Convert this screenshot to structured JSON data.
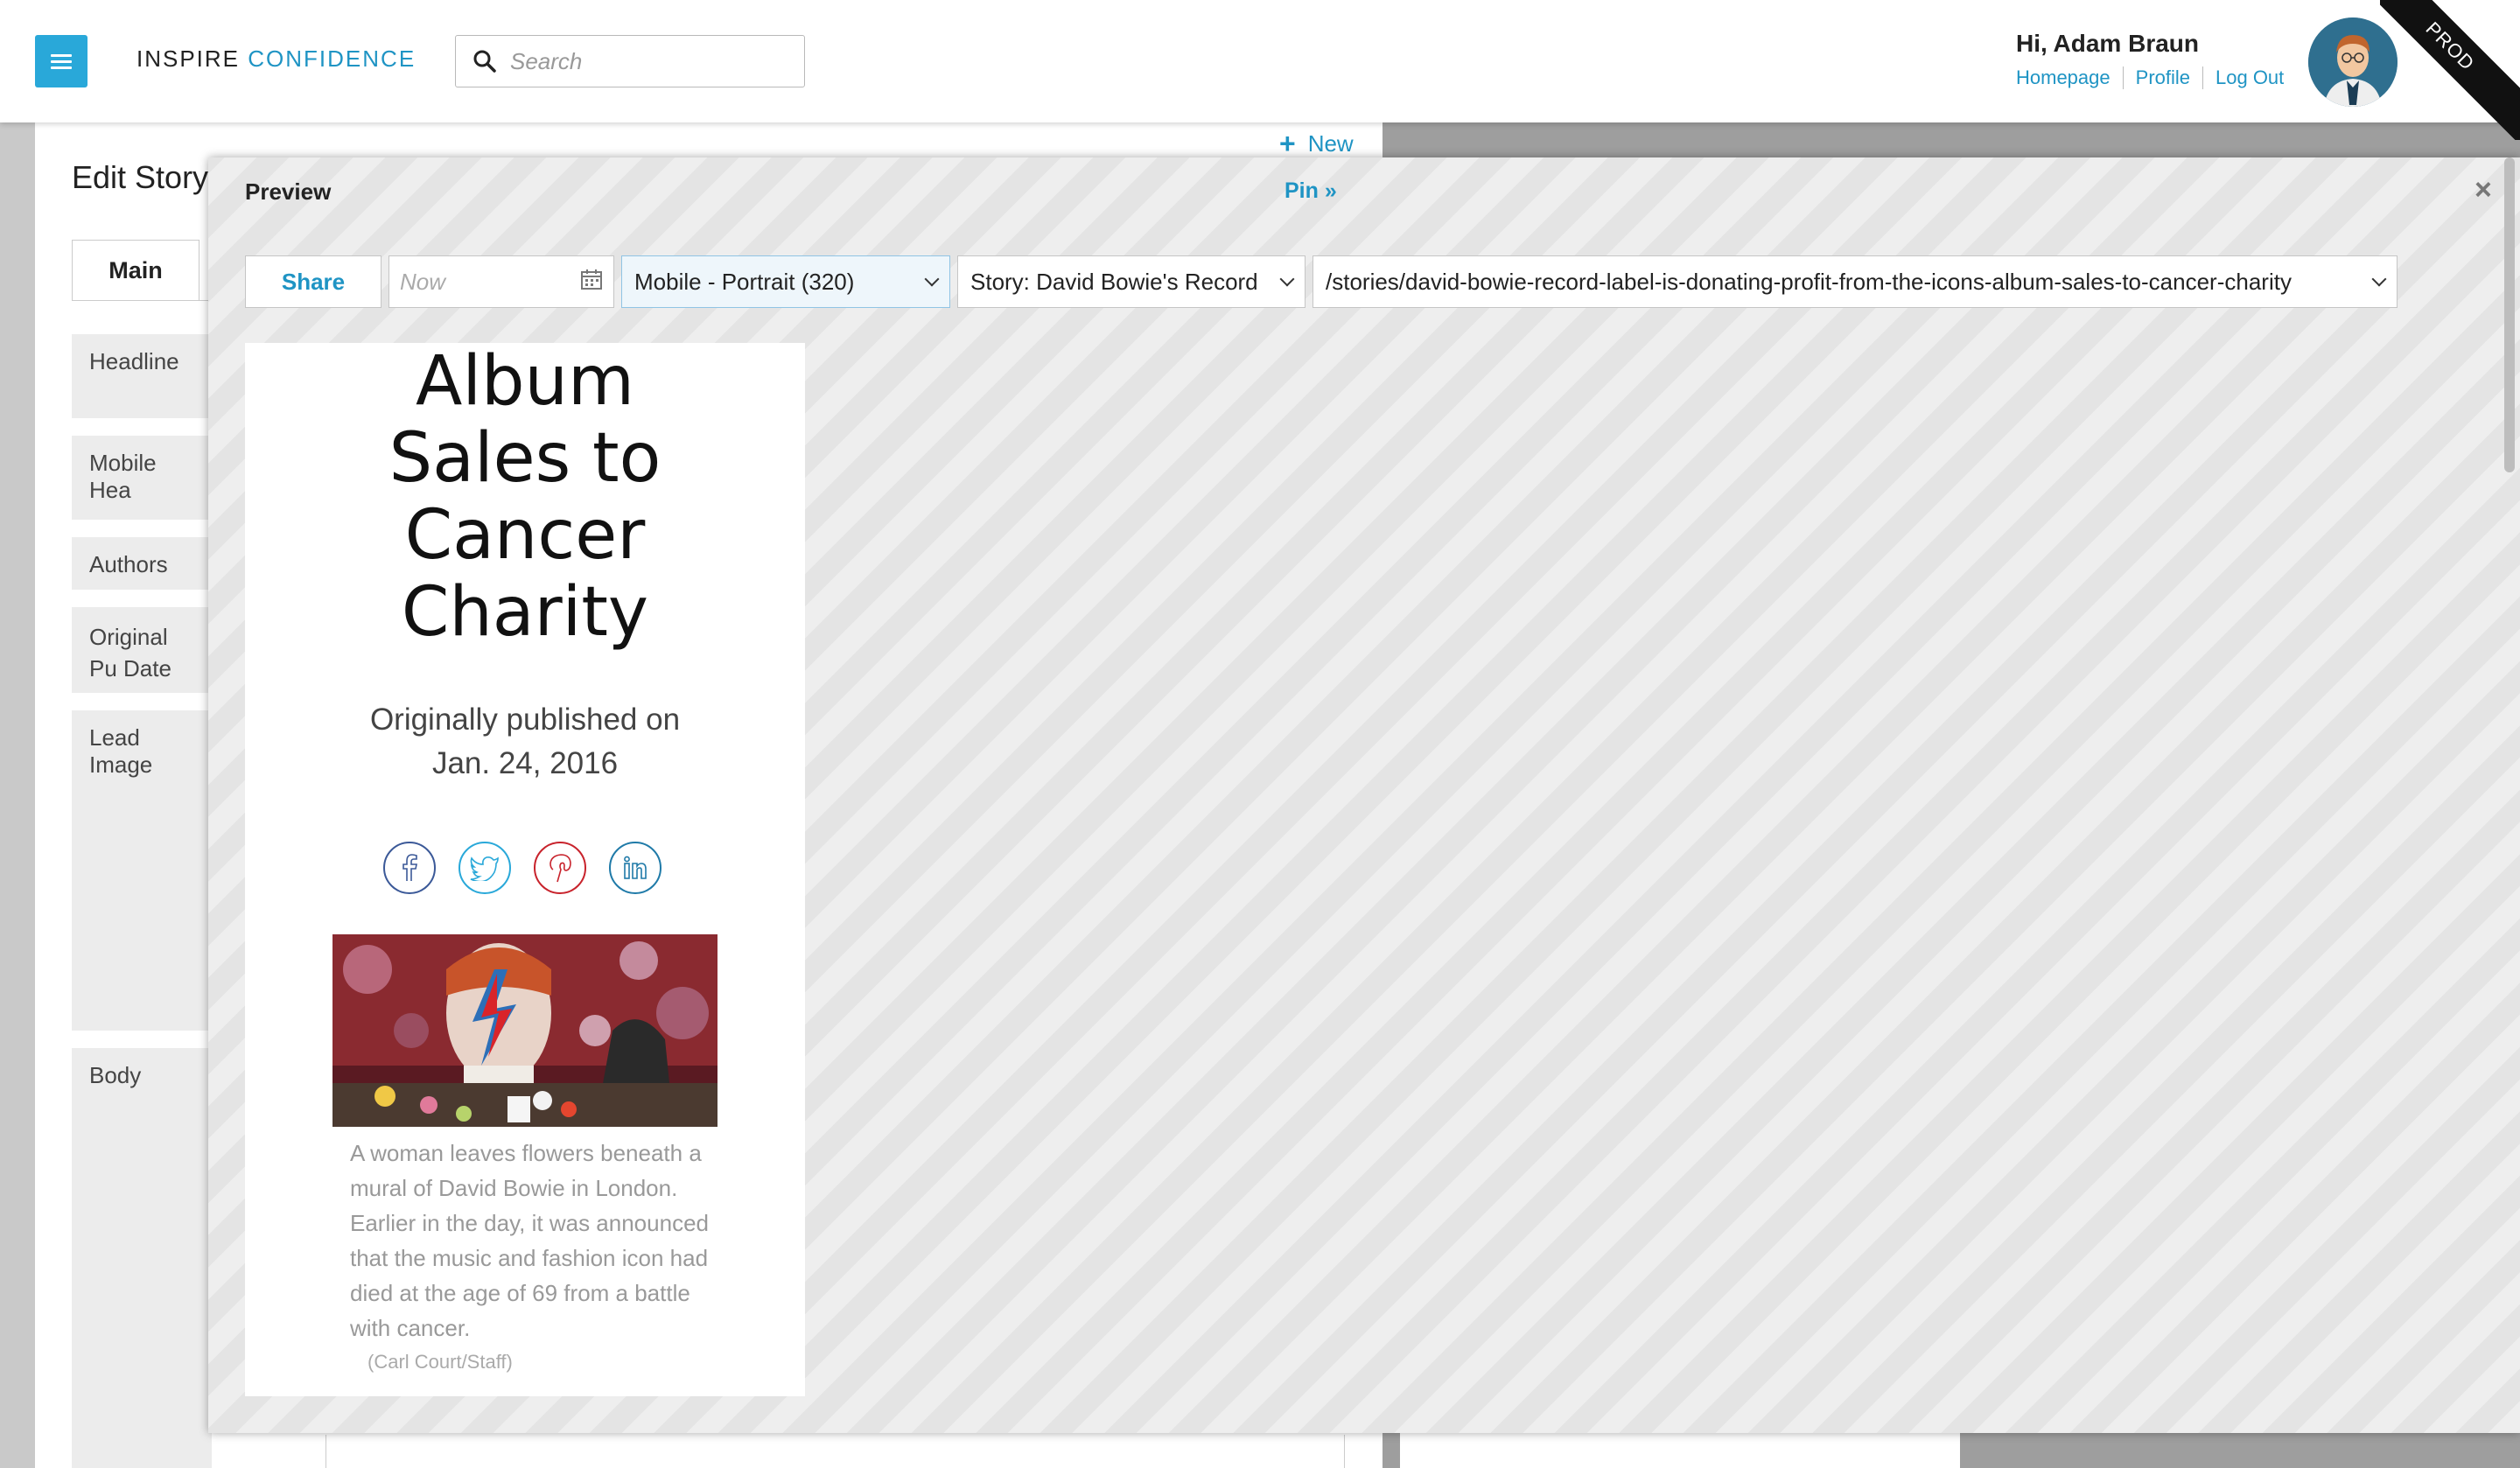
{
  "header": {
    "logo_part1": "INSPIRE",
    "logo_part2": "CONFIDENCE",
    "search_placeholder": "Search",
    "greeting": "Hi, Adam Braun",
    "links": [
      "Homepage",
      "Profile",
      "Log Out"
    ],
    "environment_badge": "PROD"
  },
  "editor": {
    "new_label": "New",
    "title": "Edit Story",
    "tab_main": "Main",
    "fields": [
      "Headline",
      "Mobile Hea",
      "Authors",
      "Original Pu Date",
      "Lead Image",
      "Body"
    ]
  },
  "preview": {
    "title": "Preview",
    "pin_label": "Pin »",
    "close_label": "×",
    "share_label": "Share",
    "date_placeholder": "Now",
    "device_selected": "Mobile - Portrait (320)",
    "story_selected": "Story: David Bowie's Record",
    "path_selected": "/stories/david-bowie-record-label-is-donating-profit-from-the-icons-album-sales-to-cancer-charity",
    "mobile": {
      "headline": "Album Sales to Cancer Charity",
      "published_line1": "Originally published on",
      "published_line2": "Jan. 24, 2016",
      "social_icons": [
        "facebook-icon",
        "twitter-icon",
        "pinterest-icon",
        "linkedin-icon"
      ],
      "image_caption": "A woman leaves flowers beneath a mural of David Bowie in London. Earlier in the day, it was announced that the music and fashion icon had died at the age of 69 from a battle with cancer.",
      "image_credit": "(Carl Court/Staff)"
    }
  },
  "colors": {
    "accent": "#1f94c4",
    "menu_button": "#29a8d9",
    "facebook": "#3b5998",
    "twitter": "#29a8d9",
    "pinterest": "#c8232c",
    "linkedin": "#1f7aa8"
  }
}
